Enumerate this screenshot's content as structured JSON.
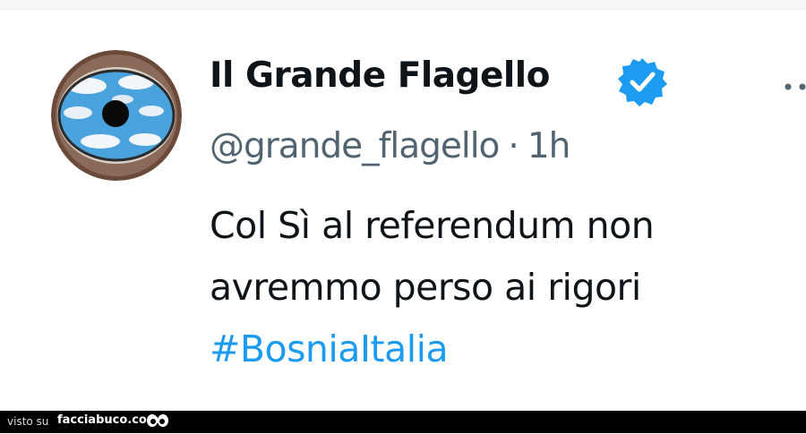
{
  "tweet": {
    "display_name": "Il Grande Flagello",
    "handle": "@grande_flagello",
    "separator": "·",
    "time": "1h",
    "text_lines": [
      "Col Sì al referendum non",
      "avremmo perso ai rigori"
    ],
    "hashtag": "#BosniaItalia"
  },
  "icons": {
    "verified": "verified-badge-icon",
    "more": "more-options-icon",
    "footer": "eyes-icon"
  },
  "footer": {
    "prefix": "visto su",
    "site": "facciabuco.com"
  },
  "colors": {
    "name": "#0f1419",
    "handle": "#536471",
    "hashtag": "#1d9bf0",
    "verified": "#1d9bf0"
  }
}
